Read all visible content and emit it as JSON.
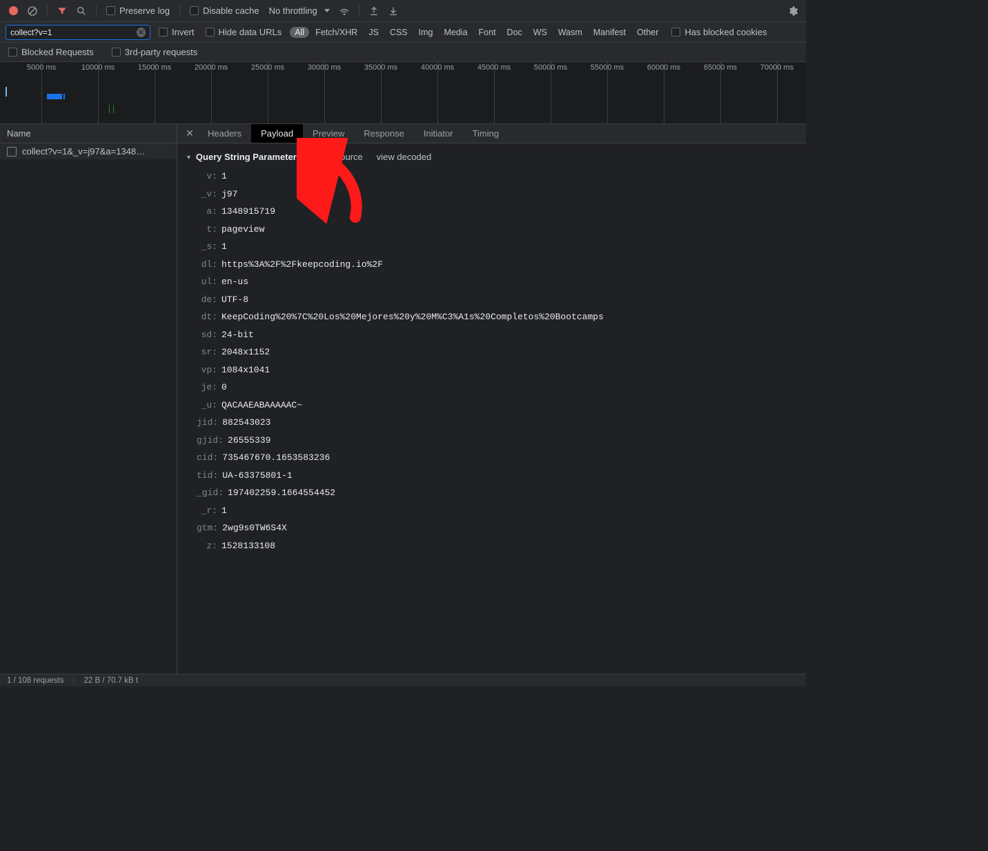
{
  "toolbar": {
    "preserve_log_label": "Preserve log",
    "disable_cache_label": "Disable cache",
    "throttling_label": "No throttling"
  },
  "filter": {
    "value": "collect?v=1",
    "invert_label": "Invert",
    "hide_data_urls_label": "Hide data URLs",
    "has_blocked_cookies_label": "Has blocked cookies",
    "blocked_requests_label": "Blocked Requests",
    "third_party_label": "3rd-party requests",
    "types": [
      "All",
      "Fetch/XHR",
      "JS",
      "CSS",
      "Img",
      "Media",
      "Font",
      "Doc",
      "WS",
      "Wasm",
      "Manifest",
      "Other"
    ]
  },
  "timeline_ticks": [
    "5000 ms",
    "10000 ms",
    "15000 ms",
    "20000 ms",
    "25000 ms",
    "30000 ms",
    "35000 ms",
    "40000 ms",
    "45000 ms",
    "50000 ms",
    "55000 ms",
    "60000 ms",
    "65000 ms",
    "70000 ms"
  ],
  "requests": {
    "name_header": "Name",
    "rows": [
      "collect?v=1&_v=j97&a=1348…"
    ]
  },
  "detail_tabs": [
    "Headers",
    "Payload",
    "Preview",
    "Response",
    "Initiator",
    "Timing"
  ],
  "active_detail_tab": "Payload",
  "payload": {
    "section_title": "Query String Parameters",
    "view_source_label": "view source",
    "view_decoded_label": "view decoded",
    "params": [
      {
        "k": "v",
        "v": "1"
      },
      {
        "k": "_v",
        "v": "j97"
      },
      {
        "k": "a",
        "v": "1348915719"
      },
      {
        "k": "t",
        "v": "pageview"
      },
      {
        "k": "_s",
        "v": "1"
      },
      {
        "k": "dl",
        "v": "https%3A%2F%2Fkeepcoding.io%2F"
      },
      {
        "k": "ul",
        "v": "en-us"
      },
      {
        "k": "de",
        "v": "UTF-8"
      },
      {
        "k": "dt",
        "v": "KeepCoding%20%7C%20Los%20Mejores%20y%20M%C3%A1s%20Completos%20Bootcamps"
      },
      {
        "k": "sd",
        "v": "24-bit"
      },
      {
        "k": "sr",
        "v": "2048x1152"
      },
      {
        "k": "vp",
        "v": "1084x1041"
      },
      {
        "k": "je",
        "v": "0"
      },
      {
        "k": "_u",
        "v": "QACAAEABAAAAAC~"
      },
      {
        "k": "jid",
        "v": "882543023"
      },
      {
        "k": "gjid",
        "v": "26555339"
      },
      {
        "k": "cid",
        "v": "735467670.1653583236"
      },
      {
        "k": "tid",
        "v": "UA-63375801-1"
      },
      {
        "k": "_gid",
        "v": "197402259.1664554452"
      },
      {
        "k": "_r",
        "v": "1"
      },
      {
        "k": "gtm",
        "v": "2wg9s0TW6S4X"
      },
      {
        "k": "z",
        "v": "1528133108"
      }
    ]
  },
  "status": {
    "requests": "1 / 108 requests",
    "transfer": "22 B / 70.7 kB t"
  }
}
